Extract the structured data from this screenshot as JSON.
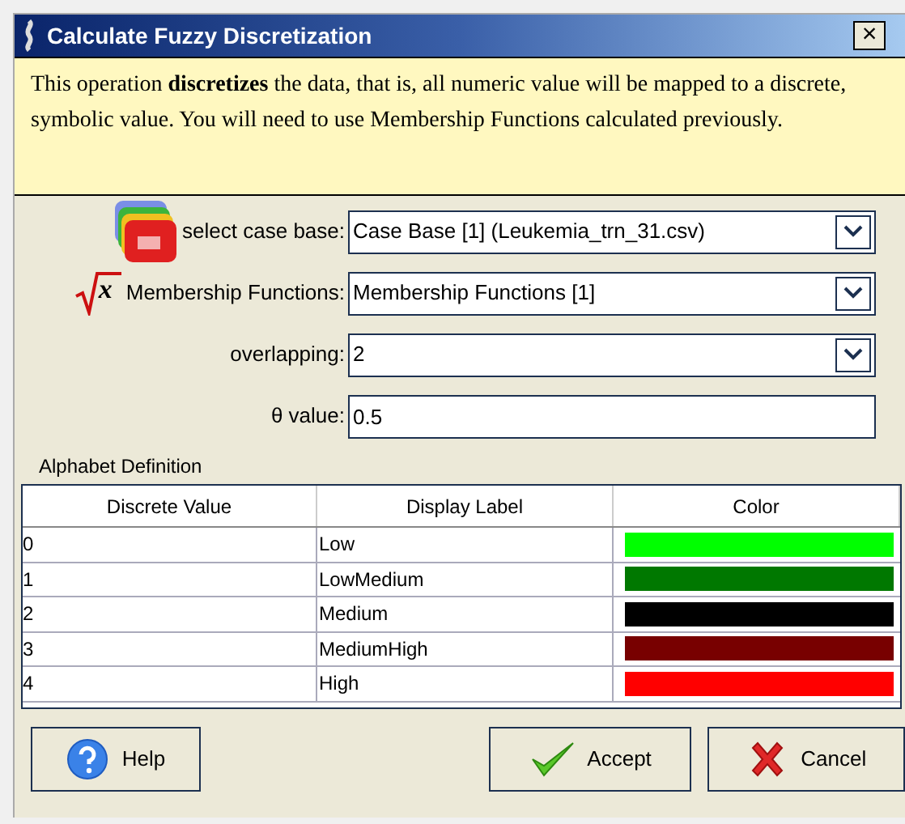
{
  "window": {
    "title": "Calculate Fuzzy Discretization",
    "close": "×"
  },
  "info": "This operation **discretizes** the data, that is, all numeric value will be mapped to a discrete, symbolic value. You will need to use Membership Functions calculated previously.",
  "fields": [
    {
      "kind": "combo",
      "label": "select case base:",
      "value": "Case Base [1] (Leukemia_trn_31.csv)"
    },
    {
      "kind": "combo",
      "symbol": "x",
      "label": "Membership Functions:",
      "value": "Membership Functions [1]"
    },
    {
      "kind": "combo",
      "label": "overlapping:",
      "value": "2"
    },
    {
      "kind": "text",
      "label": "θ value:",
      "value": "0.5"
    }
  ],
  "table": {
    "title": "Alphabet Definition",
    "columns": [
      "Discrete Value",
      "Display Label",
      "Color"
    ],
    "rows": [
      {
        "value": "0",
        "label": "Low",
        "color": "#00ff00"
      },
      {
        "value": "1",
        "label": "LowMedium",
        "color": "#007800"
      },
      {
        "value": "2",
        "label": "Medium",
        "color": "#000000"
      },
      {
        "value": "3",
        "label": "MediumHigh",
        "color": "#780000"
      },
      {
        "value": "4",
        "label": "High",
        "color": "#ff0000"
      }
    ]
  },
  "buttons": [
    {
      "kind": "help",
      "label": "Help"
    },
    {
      "kind": "accept",
      "label": "Accept"
    },
    {
      "kind": "cancel",
      "label": "Cancel"
    }
  ]
}
